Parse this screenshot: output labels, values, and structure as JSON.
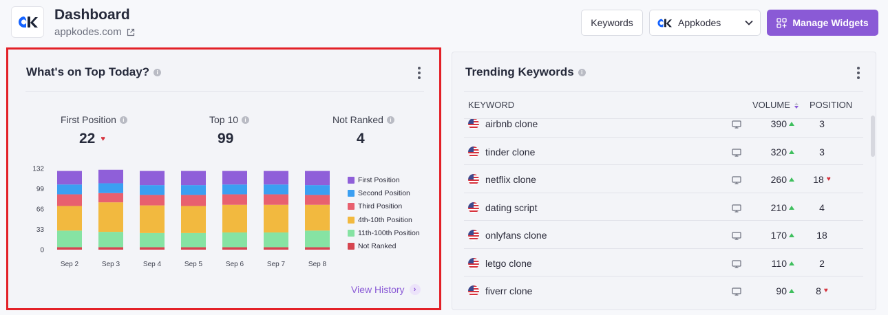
{
  "header": {
    "title": "Dashboard",
    "domain": "appkodes.com",
    "keywords_button": "Keywords",
    "project_selected": "Appkodes",
    "manage_widgets_button": "Manage Widgets",
    "brand_color": "#8a5ad6",
    "logo_text": "ak"
  },
  "top_today": {
    "title": "What's on Top Today?",
    "stats": [
      {
        "label": "First Position",
        "value": "22",
        "trend": "down"
      },
      {
        "label": "Top 10",
        "value": "99"
      },
      {
        "label": "Not Ranked",
        "value": "4"
      }
    ],
    "view_history": "View History"
  },
  "chart_data": {
    "type": "bar",
    "stacked": true,
    "categories": [
      "Sep 2",
      "Sep 3",
      "Sep 4",
      "Sep 5",
      "Sep 6",
      "Sep 7",
      "Sep 8"
    ],
    "yticks": [
      "0",
      "33",
      "66",
      "99",
      "132"
    ],
    "ylim": [
      0,
      132
    ],
    "grid": false,
    "legend_position": "right",
    "series": [
      {
        "name": "Not Ranked",
        "color": "#d64550",
        "values": [
          4,
          4,
          4,
          4,
          4,
          4,
          4
        ]
      },
      {
        "name": "11th-100th Position",
        "color": "#86e3a3",
        "values": [
          27,
          25,
          23,
          23,
          24,
          24,
          27
        ]
      },
      {
        "name": "4th-10th Position",
        "color": "#f2b93f",
        "values": [
          40,
          48,
          45,
          44,
          45,
          45,
          42
        ]
      },
      {
        "name": "Third Position",
        "color": "#e8606f",
        "values": [
          19,
          15,
          17,
          18,
          17,
          17,
          16
        ]
      },
      {
        "name": "Second Position",
        "color": "#3b9ff2",
        "values": [
          16,
          16,
          16,
          16,
          16,
          16,
          16
        ]
      },
      {
        "name": "First Position",
        "color": "#8f5fd9",
        "values": [
          22,
          22,
          23,
          23,
          22,
          22,
          23
        ]
      }
    ]
  },
  "legend_order": [
    "First Position",
    "Second Position",
    "Third Position",
    "4th-10th Position",
    "11th-100th Position",
    "Not Ranked"
  ],
  "trending": {
    "title": "Trending Keywords",
    "columns": [
      "KEYWORD",
      "VOLUME",
      "POSITION"
    ],
    "rows": [
      {
        "keyword": "airbnb clone",
        "volume": "390",
        "position": "3",
        "pos_down": false
      },
      {
        "keyword": "tinder clone",
        "volume": "320",
        "position": "3",
        "pos_down": false
      },
      {
        "keyword": "netflix clone",
        "volume": "260",
        "position": "18",
        "pos_down": true
      },
      {
        "keyword": "dating script",
        "volume": "210",
        "position": "4",
        "pos_down": false
      },
      {
        "keyword": "onlyfans clone",
        "volume": "170",
        "position": "18",
        "pos_down": false
      },
      {
        "keyword": "letgo clone",
        "volume": "110",
        "position": "2",
        "pos_down": false
      },
      {
        "keyword": "fiverr clone",
        "volume": "90",
        "position": "8",
        "pos_down": true
      }
    ]
  }
}
